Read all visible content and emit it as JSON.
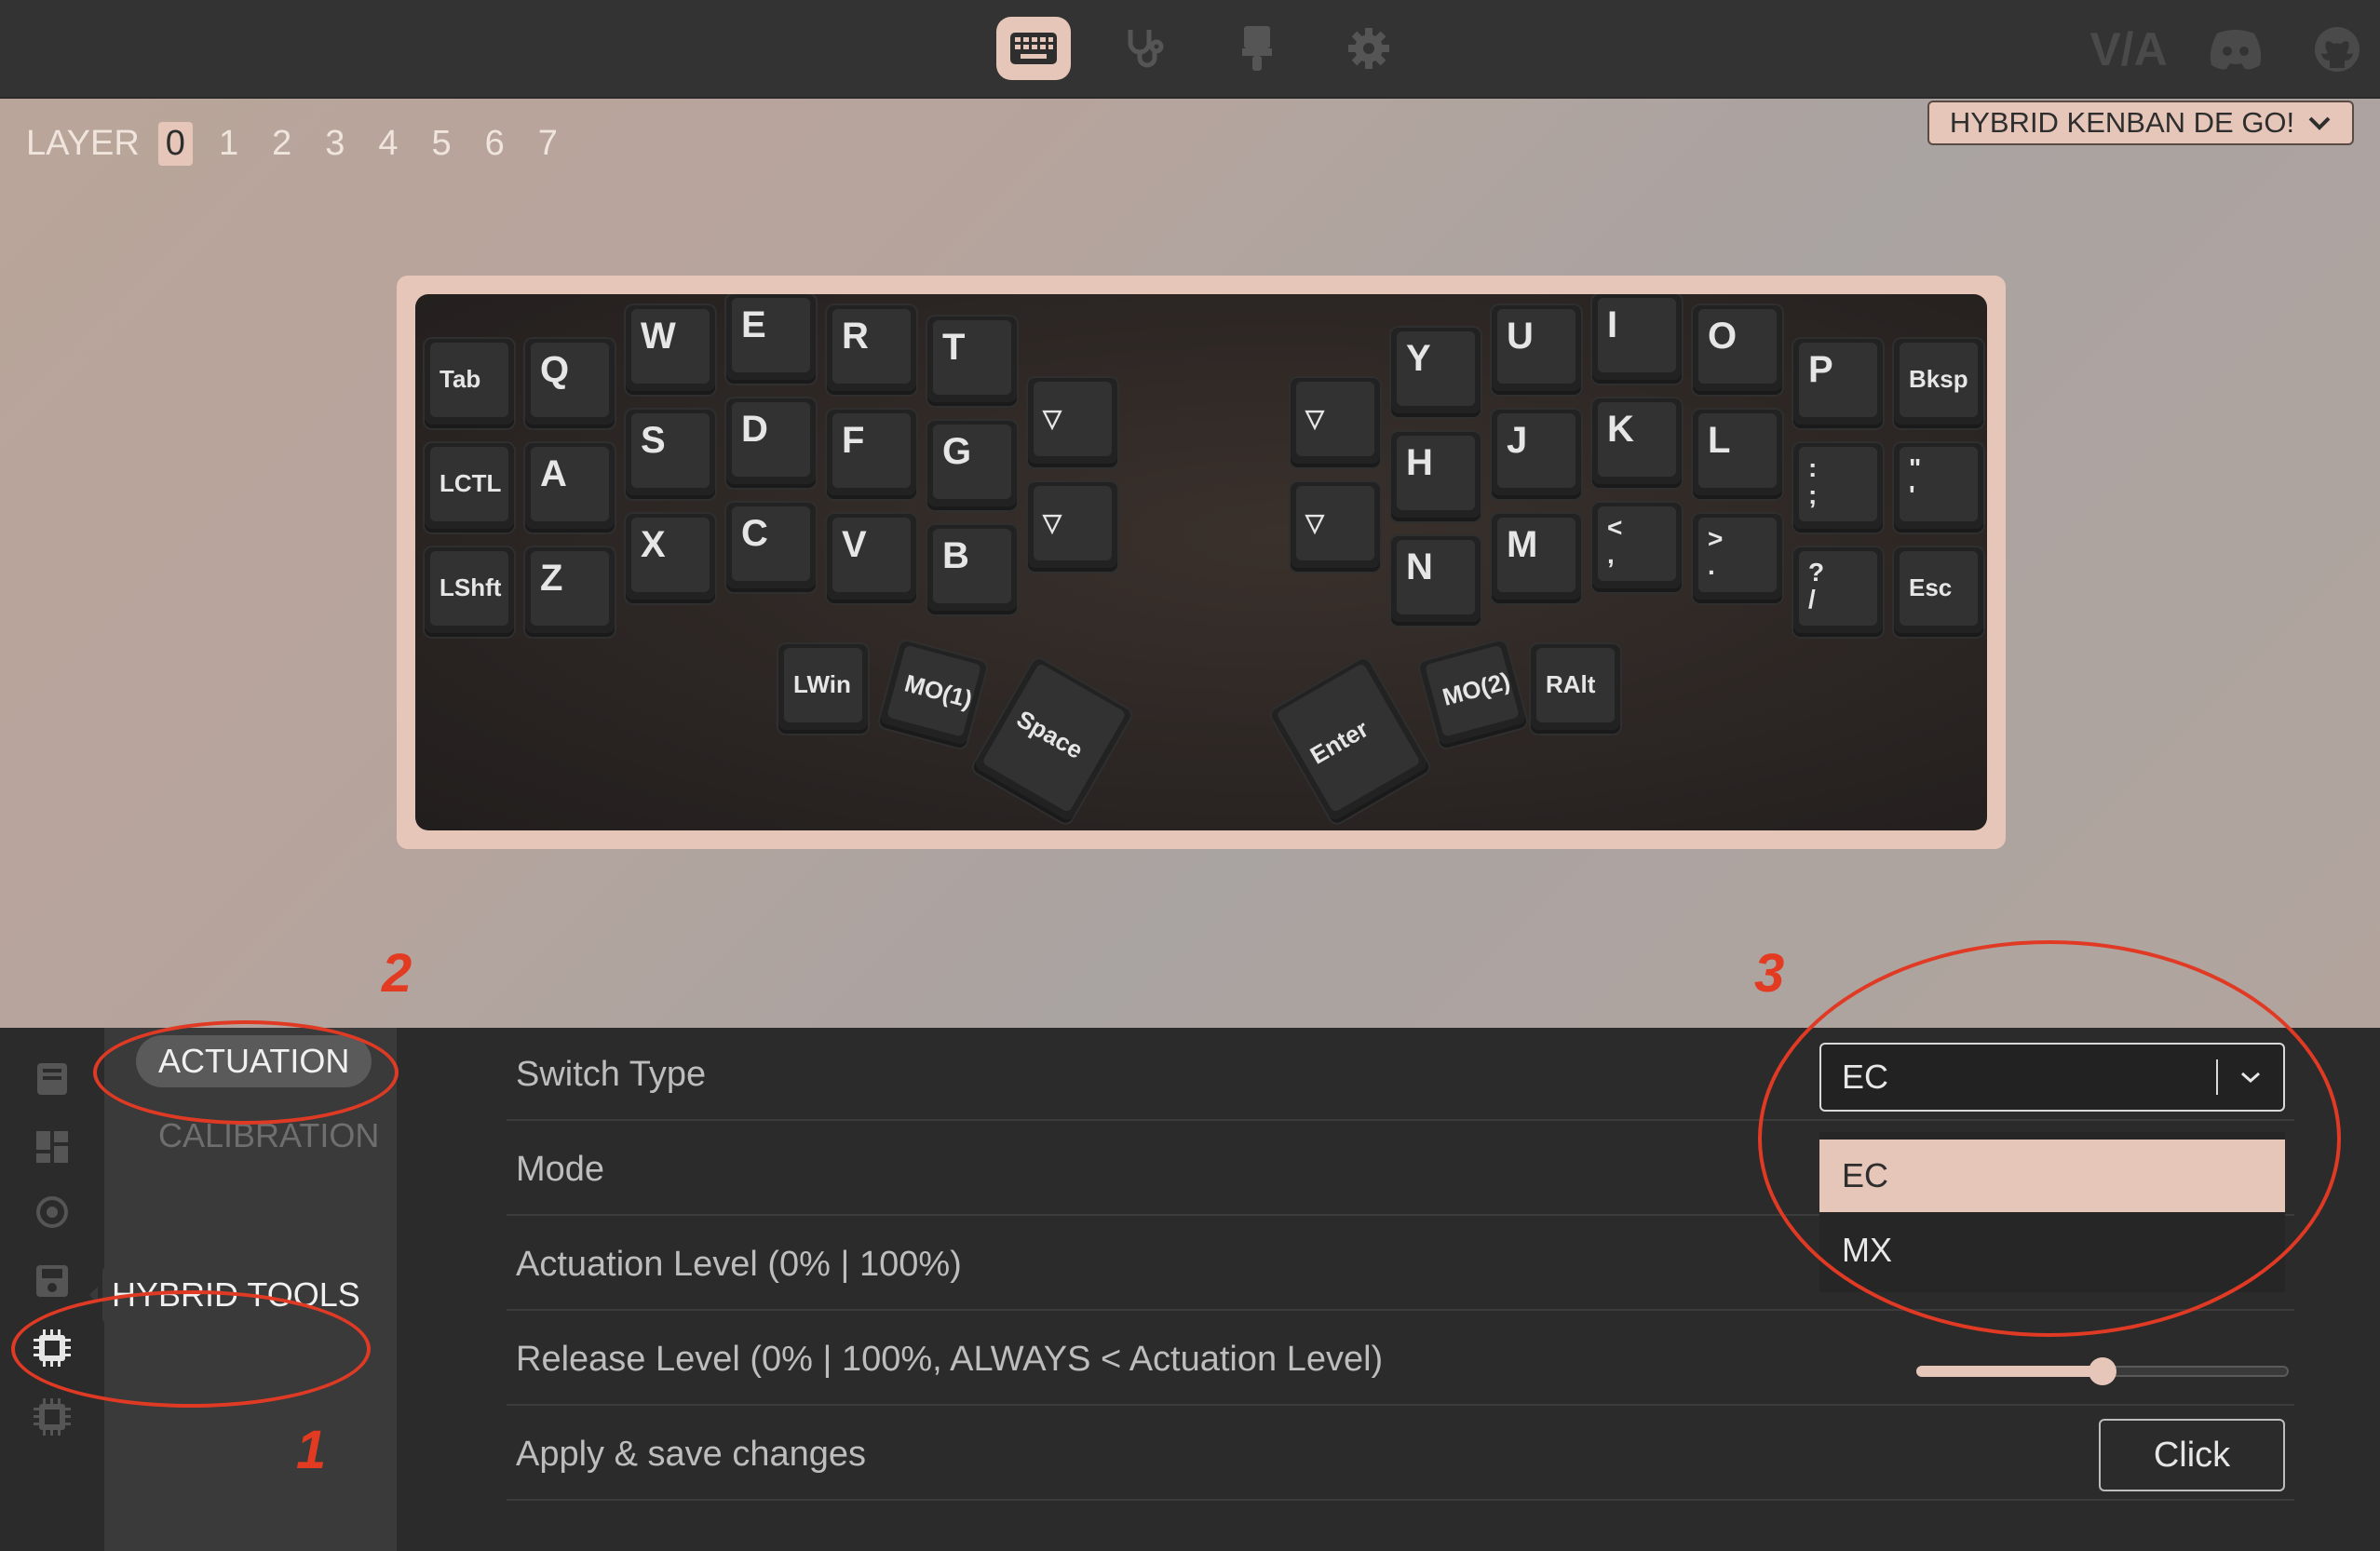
{
  "colors": {
    "accent": "#e6c6b8",
    "annotation": "#e13a24",
    "panel": "#2b2b2b"
  },
  "topbar": {
    "icons": [
      "keyboard-icon",
      "stethoscope-icon",
      "brush-icon",
      "gear-icon"
    ],
    "brand_icons": [
      "via-logo-icon",
      "discord-icon",
      "github-icon"
    ],
    "via_logo": "V/A"
  },
  "layers": {
    "label": "LAYER",
    "items": [
      "0",
      "1",
      "2",
      "3",
      "4",
      "5",
      "6",
      "7"
    ],
    "active": "0"
  },
  "keyboard_select": {
    "value": "HYBRID KENBAN DE GO!"
  },
  "keys": [
    "Tab",
    "Q",
    "W",
    "E",
    "R",
    "T",
    "▽",
    "LCTL",
    "A",
    "S",
    "D",
    "F",
    "G",
    "▽",
    "LShft",
    "Z",
    "X",
    "C",
    "V",
    "B",
    "LWin",
    "MO(1)",
    "Space",
    "▽",
    "Y",
    "U",
    "I",
    "O",
    "P",
    "Bksp",
    "▽",
    "H",
    "J",
    "K",
    "L",
    ":\n;",
    "\"\n'",
    "N",
    "M",
    "<\n,",
    ">\n.",
    "?\n/",
    "Esc",
    "Enter",
    "MO(2)",
    "RAlt"
  ],
  "annotations": {
    "n1": "1",
    "n2": "2",
    "n3": "3"
  },
  "sidebar": {
    "rail_icons": [
      "book-icon",
      "layout-icon",
      "target-icon",
      "save-icon",
      "chip-icon",
      "chip-outline-icon"
    ],
    "submenu": {
      "active": "ACTUATION",
      "inactive": "CALIBRATION"
    },
    "hybrid_tools": "HYBRID TOOLS"
  },
  "settings": {
    "rows": [
      "Switch Type",
      "Mode",
      "Actuation Level (0% | 100%)",
      "Release Level (0% | 100%, ALWAYS < Actuation Level)",
      "Apply & save changes"
    ],
    "switch_type": {
      "value": "EC",
      "options": [
        "EC",
        "MX"
      ]
    },
    "release_level_fraction": 0.5,
    "apply_button": "Click"
  }
}
